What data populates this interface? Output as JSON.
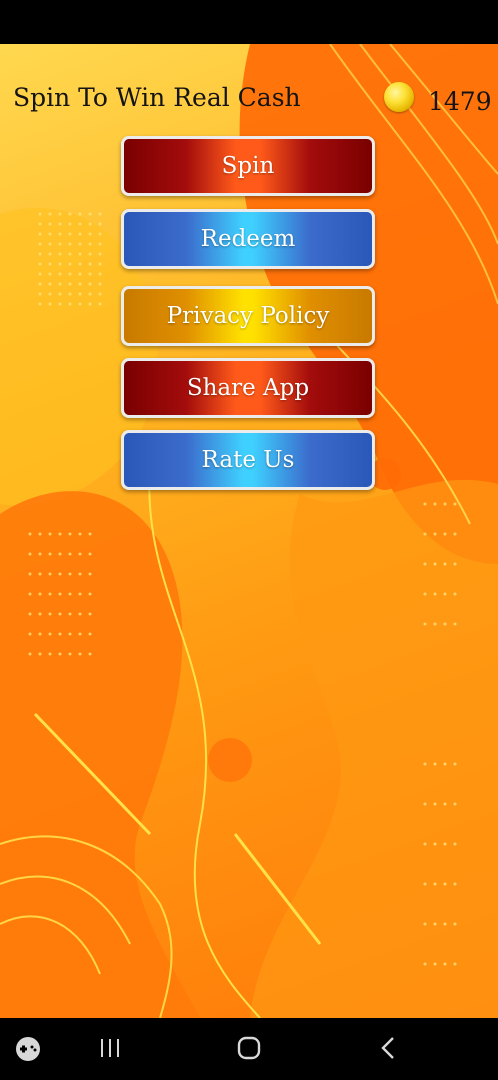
{
  "header": {
    "title": "Spin To Win Real Cash",
    "coins": "1479",
    "coin_icon": "gold-coin-icon"
  },
  "menu": {
    "items": [
      {
        "label": "Spin",
        "style": "red"
      },
      {
        "label": "Redeem",
        "style": "blue"
      },
      {
        "label": "Privacy Policy",
        "style": "gold"
      },
      {
        "label": "Share App",
        "style": "red"
      },
      {
        "label": "Rate Us",
        "style": "blue"
      }
    ]
  },
  "nav": {
    "icons": [
      "gamepad-icon",
      "recent-apps-icon",
      "home-icon",
      "back-icon"
    ]
  },
  "colors": {
    "red": "#a30c0c",
    "blue": "#3b6bcc",
    "gold": "#e08f00",
    "background": "#ffb321"
  }
}
